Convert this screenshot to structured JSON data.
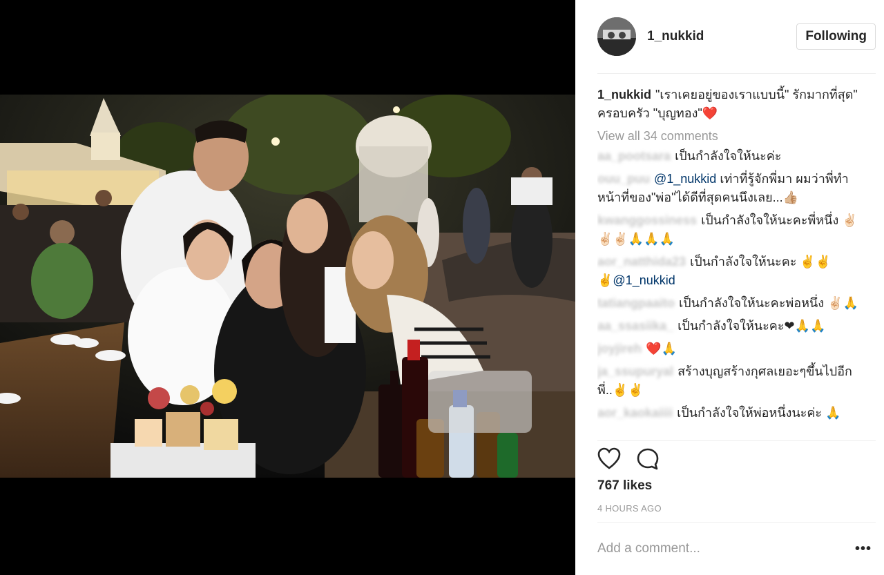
{
  "post": {
    "username": "1_nukkid",
    "follow_label": "Following",
    "caption_user": "1_nukkid",
    "caption_text": "\"เราเคยอยู่ของเราแบบนี้\" รักมากที่สุด\" ครอบครัว \"บุญทอง\"❤️",
    "view_all": "View all 34 comments",
    "likes": "767 likes",
    "time": "4 HOURS AGO",
    "add_comment_placeholder": "Add a comment...",
    "more_label": "•••"
  },
  "comments": [
    {
      "user": "aa_pootsara",
      "text": "เป็นกำลังใจให้นะค่ะ"
    },
    {
      "user": "ouu_puu",
      "mention": "@1_nukkid",
      "text": "เท่าที่รู้จักพี่มา ผมว่าพี่ทำหน้าที่ของ\"พ่อ\"ได้ดีที่สุดคนนึงเลย...👍🏼"
    },
    {
      "user": "kwanggossiness",
      "text": "เป็นกำลังใจให้นะคะพี่หนึ่ง ✌🏻✌🏻✌🏻🙏🙏🙏"
    },
    {
      "user": "aor_natthida23",
      "text": "เป็นกำลังใจให้นะคะ ✌✌",
      "mention": "✌@1_nukkid"
    },
    {
      "user": "tatiangpaaito",
      "text": "เป็นกำลังใจให้นะคะพ่อหนึ่ง ✌🏻🙏"
    },
    {
      "user": "aa_ssasiika_",
      "text": "เป็นกำลังใจให้นะคะ❤🙏🙏"
    },
    {
      "user": "joyjireh",
      "text": "❤️🙏"
    },
    {
      "user": "ja_ssupuryal",
      "text": "สร้างบุญสร้างกุศลเยอะๆขึ้นไปอีกพี่..✌✌"
    },
    {
      "user": "aor_kaokaiiii",
      "text": "เป็นกำลังใจให้พ่อหนึ่งนะค่ะ 🙏"
    }
  ],
  "colors": {
    "accent": "#e0245e",
    "muted": "#999999",
    "text": "#262626",
    "mention": "#003569"
  },
  "icons": {
    "like": "heart-icon",
    "comment": "speech-bubble-icon",
    "more": "more-options-icon"
  }
}
